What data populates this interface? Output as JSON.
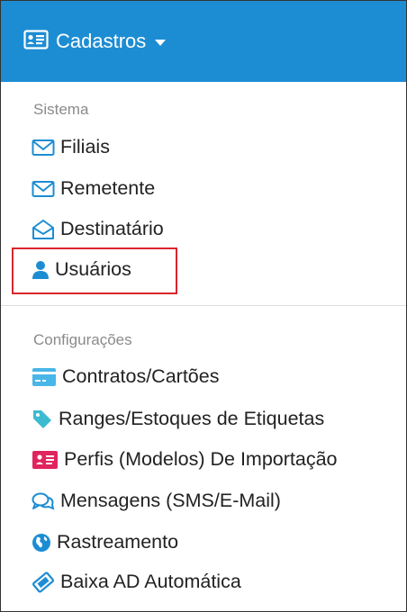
{
  "header": {
    "title": "Cadastros",
    "icon": "id-card-icon",
    "color": "#1d8dd3"
  },
  "sections": [
    {
      "label": "Sistema",
      "items": [
        {
          "label": "Filiais",
          "icon": "envelope-icon"
        },
        {
          "label": "Remetente",
          "icon": "envelope-icon"
        },
        {
          "label": "Destinatário",
          "icon": "envelope-open-icon"
        },
        {
          "label": "Usuários",
          "icon": "user-icon",
          "highlighted": true
        }
      ]
    },
    {
      "label": "Configurações",
      "items": [
        {
          "label": "Contratos/Cartões",
          "icon": "credit-card-icon"
        },
        {
          "label": "Ranges/Estoques de Etiquetas",
          "icon": "tag-icon"
        },
        {
          "label": "Perfis (Modelos) De Importação",
          "icon": "id-card-icon"
        },
        {
          "label": "Mensagens (SMS/E-Mail)",
          "icon": "comments-icon"
        },
        {
          "label": "Rastreamento",
          "icon": "globe-icon"
        },
        {
          "label": "Baixa AD Automática",
          "icon": "ticket-icon"
        }
      ]
    }
  ],
  "colors": {
    "accent": "#1d8dd3",
    "highlight_border": "#d9262c",
    "card_icon_red": "#e0245e"
  }
}
